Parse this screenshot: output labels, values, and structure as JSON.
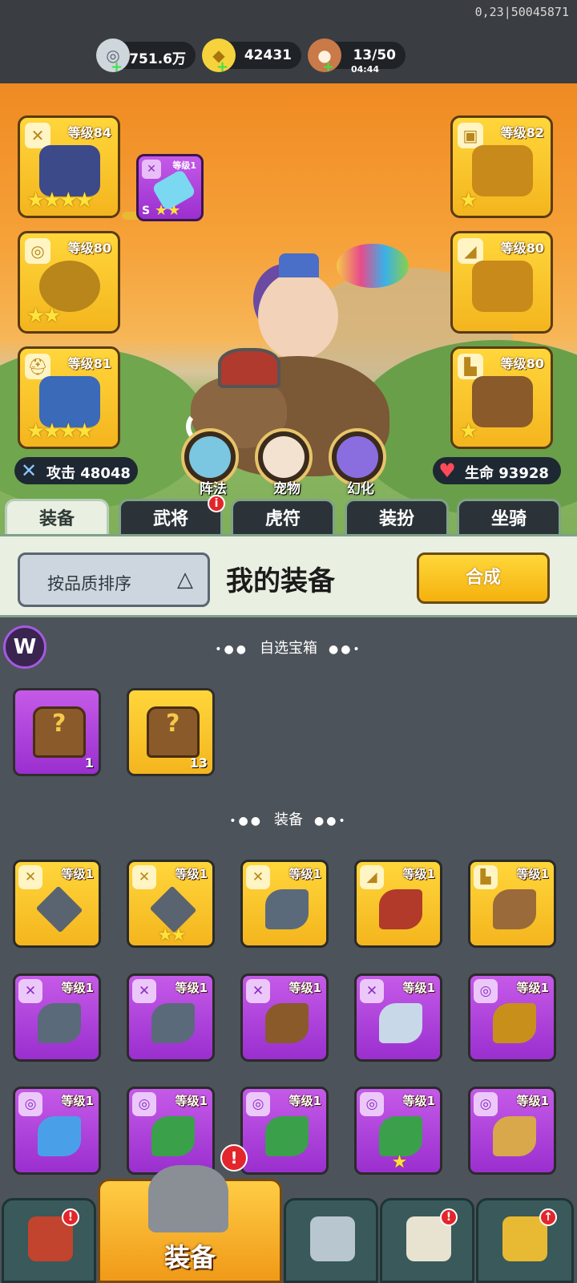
{
  "status": {
    "version": "0,23|50045871"
  },
  "resources": [
    {
      "icon": "silver-coin-icon",
      "value": "751.6万"
    },
    {
      "icon": "gold-ingot-icon",
      "value": "42431"
    },
    {
      "icon": "meat-drumstick-icon",
      "value": "13/50",
      "timer": "04:44"
    }
  ],
  "equipment_slots": {
    "left": [
      {
        "type": "weapon",
        "icon": "sword-icon",
        "level": "等级84",
        "stars": "★★★★"
      },
      {
        "type": "amulet",
        "icon": "medal-icon",
        "level": "等级80",
        "stars": "★★"
      },
      {
        "type": "helmet",
        "icon": "helmet-icon",
        "level": "等级81",
        "stars": "★★★★"
      }
    ],
    "right": [
      {
        "type": "armor",
        "icon": "armor-icon",
        "level": "等级82",
        "stars": "★"
      },
      {
        "type": "bracer",
        "icon": "bracer-icon",
        "level": "等级80",
        "stars": ""
      },
      {
        "type": "boots",
        "icon": "boots-icon",
        "level": "等级80",
        "stars": "★"
      }
    ],
    "gem": {
      "icon": "sword-icon",
      "level": "等级1",
      "rank": "S",
      "stars": "★★"
    }
  },
  "actions": [
    {
      "label": "阵法",
      "icon": "formation-icon"
    },
    {
      "label": "宠物",
      "icon": "pet-cat-icon"
    },
    {
      "label": "幻化",
      "icon": "transform-icon"
    }
  ],
  "stats": {
    "attack": "攻击 48048",
    "hp": "生命 93928",
    "attack_icon": "sword-icon",
    "hp_icon": "heart-icon"
  },
  "tabs": [
    {
      "label": "装备",
      "active": true
    },
    {
      "label": "武将",
      "alert": "i"
    },
    {
      "label": "虎符"
    },
    {
      "label": "装扮"
    },
    {
      "label": "坐骑"
    }
  ],
  "sort": {
    "label": "按品质排序",
    "arrow": "△"
  },
  "title": "我的装备",
  "synth_label": "合成",
  "logo_letter": "W",
  "sections": {
    "chests": "自选宝箱",
    "equipment": "装备"
  },
  "section_dots_left": "•●●",
  "section_dots_right": "●●•",
  "chests": [
    {
      "quality": "purple",
      "count": "1"
    },
    {
      "quality": "gold",
      "count": "13"
    }
  ],
  "items": [
    {
      "quality": "gold",
      "icon": "sword-icon",
      "art": "shuriken",
      "level": "等级1",
      "stars": ""
    },
    {
      "quality": "gold",
      "icon": "sword-icon",
      "art": "shuriken",
      "level": "等级1",
      "stars": "★★"
    },
    {
      "quality": "gold",
      "icon": "sword-icon",
      "art": "blade",
      "level": "等级1",
      "stars": ""
    },
    {
      "quality": "gold",
      "icon": "bracer-icon",
      "art": "bracer",
      "level": "等级1",
      "stars": ""
    },
    {
      "quality": "gold",
      "icon": "boots-icon",
      "art": "boots",
      "level": "等级1",
      "stars": ""
    },
    {
      "quality": "purple",
      "icon": "sword-icon",
      "art": "blade",
      "level": "等级1",
      "stars": ""
    },
    {
      "quality": "purple",
      "icon": "sword-icon",
      "art": "blade",
      "level": "等级1",
      "stars": ""
    },
    {
      "quality": "purple",
      "icon": "sword-icon",
      "art": "crossbow",
      "level": "等级1",
      "stars": ""
    },
    {
      "quality": "purple",
      "icon": "sword-icon",
      "art": "broadsword",
      "level": "等级1",
      "stars": ""
    },
    {
      "quality": "purple",
      "icon": "medal-icon",
      "art": "amulet",
      "level": "等级1",
      "stars": ""
    },
    {
      "quality": "purple",
      "icon": "medal-icon",
      "art": "gem-amulet",
      "level": "等级1",
      "stars": ""
    },
    {
      "quality": "purple",
      "icon": "medal-icon",
      "art": "jade-amulet",
      "level": "等级1",
      "stars": ""
    },
    {
      "quality": "purple",
      "icon": "medal-icon",
      "art": "jade-amulet",
      "level": "等级1",
      "stars": ""
    },
    {
      "quality": "purple",
      "icon": "medal-icon",
      "art": "jade-amulet",
      "level": "等级1",
      "stars": "★"
    },
    {
      "quality": "purple",
      "icon": "medal-icon",
      "art": "talisman",
      "level": "等级1",
      "stars": ""
    }
  ],
  "bottom_nav": [
    {
      "icon": "shop-gate-icon",
      "alert": "!"
    },
    {
      "icon": "helmet-icon",
      "label": "装备",
      "active": true,
      "alert": "!"
    },
    {
      "icon": "crossed-swords-icon"
    },
    {
      "icon": "war-horn-icon",
      "alert": "!"
    },
    {
      "icon": "fist-upgrade-icon",
      "alert": "↑"
    }
  ],
  "colors": {
    "gold_quality": "#f4b51e",
    "purple_quality": "#9a2fcf",
    "alert_red": "#e2262c",
    "panel_bg": "#4d535a"
  }
}
